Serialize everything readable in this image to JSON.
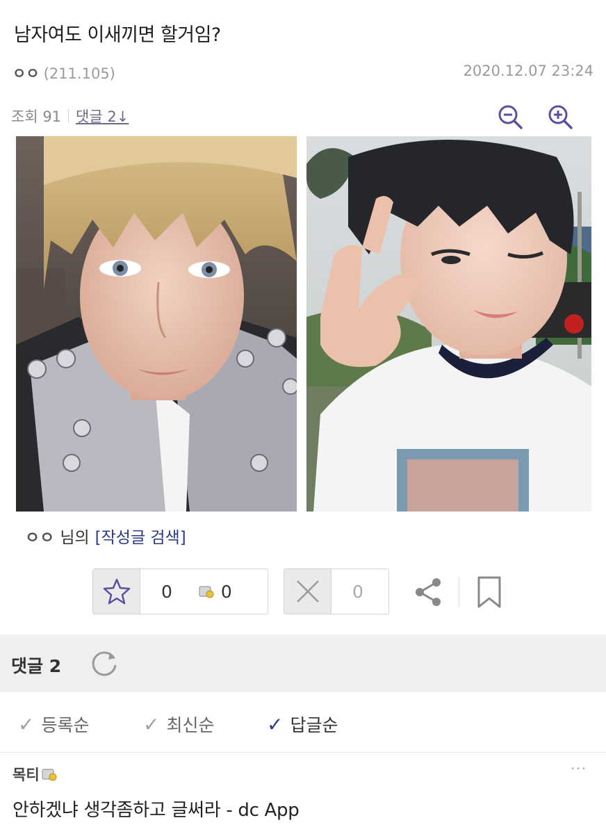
{
  "post": {
    "title": "남자여도 이새끼면 할거임?",
    "author_nick": "ㅇㅇ",
    "author_ip": "(211.105)",
    "date": "2020.12.07 23:24",
    "views_label": "조회 91",
    "comments_link": "댓글 2↓"
  },
  "zoom": {
    "out_icon": "zoom-out-icon",
    "in_icon": "zoom-in-icon"
  },
  "images": [
    {
      "icon": "photo",
      "subject": "blonde-haired person selfie, studded jacket"
    },
    {
      "icon": "photo",
      "subject": "dark-haired person winking with V sign, white t-shirt"
    }
  ],
  "writer": {
    "nick": "ㅇㅇ",
    "suffix": "님의",
    "search_link": "[작성글 검색]"
  },
  "votes": {
    "up_count": "0",
    "fixed_up_count": "0",
    "down_count": "0"
  },
  "actions": {
    "share_icon": "share-icon",
    "bookmark_icon": "bookmark-icon"
  },
  "comments": {
    "header_label": "댓글 2",
    "sort_options": [
      {
        "check": "✓",
        "label": "등록순",
        "active": false
      },
      {
        "check": "✓",
        "label": "최신순",
        "active": false
      },
      {
        "check": "✓",
        "label": "답글순",
        "active": true
      }
    ],
    "items": [
      {
        "nick": "목티",
        "more": "···",
        "body": "안하겠냐 생각좀하고 글써라 - dc App"
      }
    ]
  },
  "colors": {
    "accent": "#2a3a8c",
    "icon_purple": "#5a4fa0",
    "header_bg": "#efefef"
  }
}
